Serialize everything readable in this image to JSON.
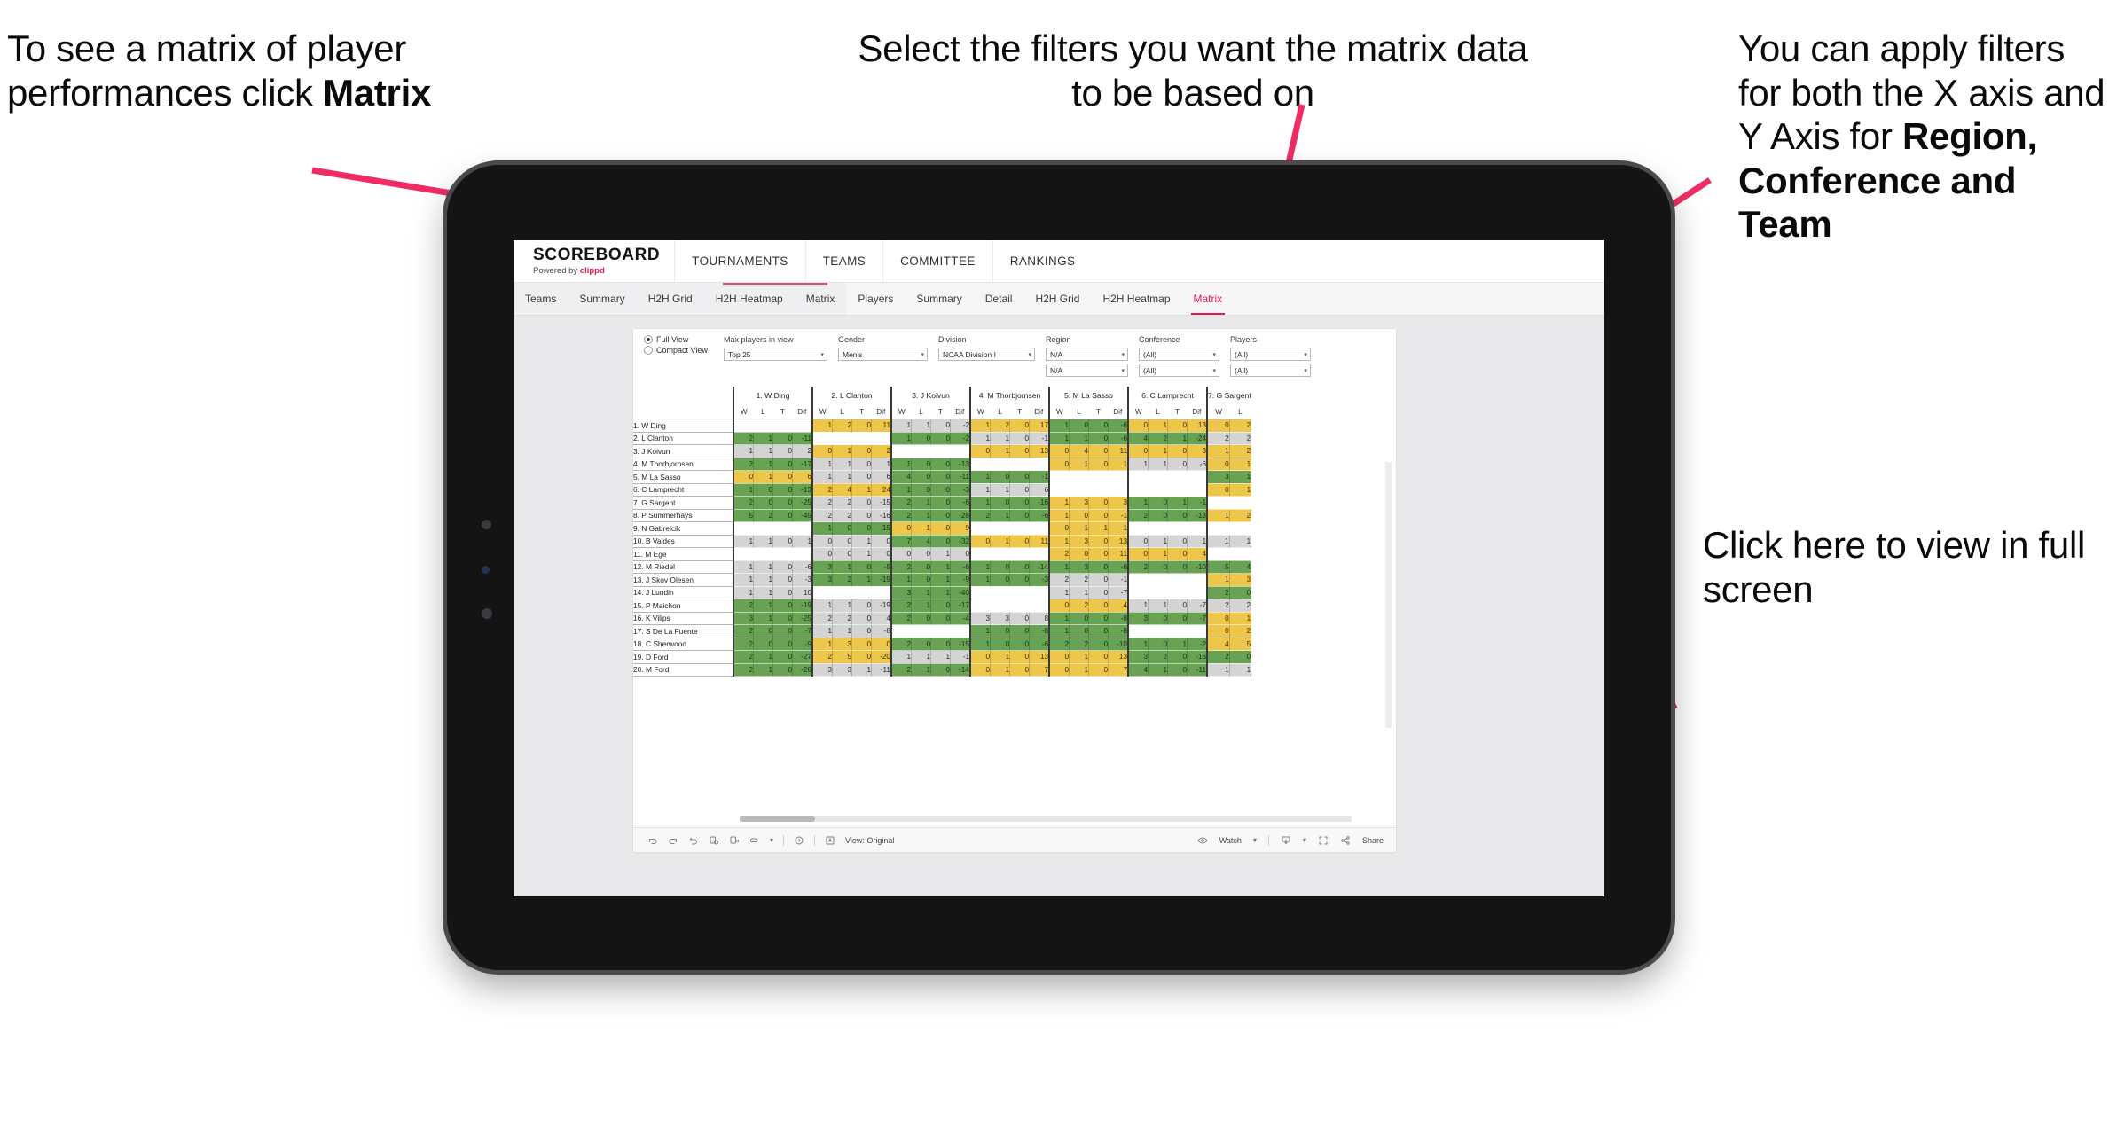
{
  "annotations": {
    "left": {
      "t1": "To see a matrix of player performances click ",
      "bold": "Matrix"
    },
    "middle": {
      "t1": "Select the filters you want the matrix data to be based on"
    },
    "right": {
      "t1": "You  can apply filters for both the X axis and Y Axis for ",
      "bold": "Region, Conference and Team"
    },
    "bottom": {
      "t1": "Click here to view in full screen"
    }
  },
  "brand": {
    "name": "SCOREBOARD",
    "powered": "Powered by ",
    "vendor": "clippd"
  },
  "topnav": [
    "TOURNAMENTS",
    "TEAMS",
    "COMMITTEE",
    "RANKINGS"
  ],
  "subnav": {
    "teams_group": [
      "Teams",
      "Summary",
      "H2H Grid",
      "H2H Heatmap",
      "Matrix"
    ],
    "players_group": [
      "Players",
      "Summary",
      "Detail",
      "H2H Grid",
      "H2H Heatmap",
      "Matrix"
    ],
    "active": "Matrix"
  },
  "filters": {
    "view_full": "Full View",
    "view_compact": "Compact View",
    "max_players_label": "Max players in view",
    "max_players_value": "Top 25",
    "gender_label": "Gender",
    "gender_value": "Men's",
    "division_label": "Division",
    "division_value": "NCAA Division I",
    "region_label": "Region",
    "region_value_x": "N/A",
    "region_value_y": "N/A",
    "conference_label": "Conference",
    "conference_value_x": "(All)",
    "conference_value_y": "(All)",
    "players_label": "Players",
    "players_value_x": "(All)",
    "players_value_y": "(All)"
  },
  "toolbar": {
    "view_label": "View: Original",
    "watch_label": "Watch",
    "share_label": "Share"
  },
  "chart_data": {
    "type": "table",
    "title": "Player head-to-head performance matrix",
    "sub_columns": [
      "W",
      "L",
      "T",
      "Dif"
    ],
    "column_players": [
      "1. W Ding",
      "2. L Clanton",
      "3. J Koivun",
      "4. M Thorbjornsen",
      "5. M La Sasso",
      "6. C Lamprecht",
      "7. G Sargent"
    ],
    "column_players_partial": "7. G Sargent",
    "row_players": [
      "1. W Ding",
      "2. L Clanton",
      "3. J Koivun",
      "4. M Thorbjornsen",
      "5. M La Sasso",
      "6. C Lamprecht",
      "7. G Sargent",
      "8. P Summerhays",
      "9. N Gabrelcik",
      "10. B Valdes",
      "11. M Ege",
      "12. M Riedel",
      "13. J Skov Olesen",
      "14. J Lundin",
      "15. P Maichon",
      "16. K Vilips",
      "17. S De La Fuente",
      "18. C Sherwood",
      "19. D Ford",
      "20. M Ford"
    ],
    "color_key": {
      "win": "#67a353",
      "loss": "#eec64a",
      "neutral": "#d4d4d4",
      "empty": "#ffffff"
    },
    "rows": [
      {
        "player": "1. W Ding",
        "cells": [
          [
            null,
            null,
            null,
            null,
            "e"
          ],
          [
            "1",
            "2",
            "0",
            "11",
            "y"
          ],
          [
            "1",
            "1",
            "0",
            "-2",
            "n"
          ],
          [
            "1",
            "2",
            "0",
            "17",
            "y"
          ],
          [
            "1",
            "0",
            "0",
            "-6",
            "g"
          ],
          [
            "0",
            "1",
            "0",
            "13",
            "y"
          ],
          [
            "0",
            "2",
            null,
            null,
            "y"
          ]
        ]
      },
      {
        "player": "2. L Clanton",
        "cells": [
          [
            "2",
            "1",
            "0",
            "-11",
            "g"
          ],
          [
            null,
            null,
            null,
            null,
            "e"
          ],
          [
            "1",
            "0",
            "0",
            "-2",
            "g"
          ],
          [
            "1",
            "1",
            "0",
            "-1",
            "n"
          ],
          [
            "1",
            "1",
            "0",
            "-6",
            "g"
          ],
          [
            "4",
            "2",
            "1",
            "-24",
            "g"
          ],
          [
            "2",
            "2",
            null,
            null,
            "n"
          ]
        ]
      },
      {
        "player": "3. J Koivun",
        "cells": [
          [
            "1",
            "1",
            "0",
            "2",
            "n"
          ],
          [
            "0",
            "1",
            "0",
            "2",
            "y"
          ],
          [
            null,
            null,
            null,
            null,
            "e"
          ],
          [
            "0",
            "1",
            "0",
            "13",
            "y"
          ],
          [
            "0",
            "4",
            "0",
            "11",
            "y"
          ],
          [
            "0",
            "1",
            "0",
            "3",
            "y"
          ],
          [
            "1",
            "2",
            null,
            null,
            "y"
          ]
        ]
      },
      {
        "player": "4. M Thorbjornsen",
        "cells": [
          [
            "2",
            "1",
            "0",
            "-17",
            "g"
          ],
          [
            "1",
            "1",
            "0",
            "1",
            "n"
          ],
          [
            "1",
            "0",
            "0",
            "-13",
            "g"
          ],
          [
            null,
            null,
            null,
            null,
            "e"
          ],
          [
            "0",
            "1",
            "0",
            "1",
            "y"
          ],
          [
            "1",
            "1",
            "0",
            "-6",
            "n"
          ],
          [
            "0",
            "1",
            null,
            null,
            "y"
          ]
        ]
      },
      {
        "player": "5. M La Sasso",
        "cells": [
          [
            "0",
            "1",
            "0",
            "6",
            "y"
          ],
          [
            "1",
            "1",
            "0",
            "6",
            "n"
          ],
          [
            "4",
            "0",
            "0",
            "-11",
            "g"
          ],
          [
            "1",
            "0",
            "0",
            "-1",
            "g"
          ],
          [
            null,
            null,
            null,
            null,
            "e"
          ],
          [
            null,
            null,
            null,
            null,
            "e"
          ],
          [
            "3",
            "1",
            null,
            null,
            "g"
          ]
        ]
      },
      {
        "player": "6. C Lamprecht",
        "cells": [
          [
            "1",
            "0",
            "0",
            "-13",
            "g"
          ],
          [
            "2",
            "4",
            "1",
            "24",
            "y"
          ],
          [
            "1",
            "0",
            "0",
            "-3",
            "g"
          ],
          [
            "1",
            "1",
            "0",
            "6",
            "n"
          ],
          [
            null,
            null,
            null,
            null,
            "e"
          ],
          [
            null,
            null,
            null,
            null,
            "e"
          ],
          [
            "0",
            "1",
            null,
            null,
            "y"
          ]
        ]
      },
      {
        "player": "7. G Sargent",
        "cells": [
          [
            "2",
            "0",
            "0",
            "-25",
            "g"
          ],
          [
            "2",
            "2",
            "0",
            "-15",
            "n"
          ],
          [
            "2",
            "1",
            "0",
            "-6",
            "g"
          ],
          [
            "1",
            "0",
            "0",
            "-16",
            "g"
          ],
          [
            "1",
            "3",
            "0",
            "3",
            "y"
          ],
          [
            "1",
            "0",
            "1",
            "-1",
            "g"
          ],
          [
            null,
            null,
            null,
            null,
            "e"
          ]
        ]
      },
      {
        "player": "8. P Summerhays",
        "cells": [
          [
            "5",
            "2",
            "0",
            "-45",
            "g"
          ],
          [
            "2",
            "2",
            "0",
            "-16",
            "n"
          ],
          [
            "2",
            "1",
            "0",
            "-28",
            "g"
          ],
          [
            "2",
            "1",
            "0",
            "-6",
            "g"
          ],
          [
            "1",
            "0",
            "0",
            "-1",
            "y"
          ],
          [
            "2",
            "0",
            "0",
            "-13",
            "g"
          ],
          [
            "1",
            "2",
            null,
            null,
            "y"
          ]
        ]
      },
      {
        "player": "9. N Gabrelcik",
        "cells": [
          [
            null,
            null,
            null,
            null,
            "e"
          ],
          [
            "1",
            "0",
            "0",
            "-15",
            "g"
          ],
          [
            "0",
            "1",
            "0",
            "9",
            "y"
          ],
          [
            null,
            null,
            null,
            null,
            "e"
          ],
          [
            "0",
            "1",
            "1",
            "1",
            "y"
          ],
          [
            null,
            null,
            null,
            null,
            "e"
          ],
          [
            null,
            null,
            null,
            null,
            "e"
          ]
        ]
      },
      {
        "player": "10. B Valdes",
        "cells": [
          [
            "1",
            "1",
            "0",
            "1",
            "n"
          ],
          [
            "0",
            "0",
            "1",
            "0",
            "n"
          ],
          [
            "7",
            "4",
            "0",
            "-32",
            "g"
          ],
          [
            "0",
            "1",
            "0",
            "11",
            "y"
          ],
          [
            "1",
            "3",
            "0",
            "13",
            "y"
          ],
          [
            "0",
            "1",
            "0",
            "1",
            "n"
          ],
          [
            "1",
            "1",
            null,
            null,
            "n"
          ]
        ]
      },
      {
        "player": "11. M Ege",
        "cells": [
          [
            null,
            null,
            null,
            null,
            "e"
          ],
          [
            "0",
            "0",
            "1",
            "0",
            "n"
          ],
          [
            "0",
            "0",
            "1",
            "0",
            "n"
          ],
          [
            null,
            null,
            null,
            null,
            "e"
          ],
          [
            "2",
            "0",
            "0",
            "11",
            "y"
          ],
          [
            "0",
            "1",
            "0",
            "4",
            "y"
          ],
          [
            null,
            null,
            null,
            null,
            "e"
          ]
        ]
      },
      {
        "player": "12. M Riedel",
        "cells": [
          [
            "1",
            "1",
            "0",
            "-6",
            "n"
          ],
          [
            "3",
            "1",
            "0",
            "-5",
            "g"
          ],
          [
            "2",
            "0",
            "1",
            "-6",
            "g"
          ],
          [
            "1",
            "0",
            "0",
            "-14",
            "g"
          ],
          [
            "1",
            "3",
            "0",
            "-6",
            "g"
          ],
          [
            "2",
            "0",
            "0",
            "-10",
            "g"
          ],
          [
            "5",
            "4",
            null,
            null,
            "g"
          ]
        ]
      },
      {
        "player": "13. J Skov Olesen",
        "cells": [
          [
            "1",
            "1",
            "0",
            "-3",
            "n"
          ],
          [
            "3",
            "2",
            "1",
            "-19",
            "g"
          ],
          [
            "1",
            "0",
            "1",
            "-9",
            "g"
          ],
          [
            "1",
            "0",
            "0",
            "-3",
            "g"
          ],
          [
            "2",
            "2",
            "0",
            "-1",
            "n"
          ],
          [
            null,
            null,
            null,
            null,
            "e"
          ],
          [
            "1",
            "3",
            null,
            null,
            "y"
          ]
        ]
      },
      {
        "player": "14. J Lundin",
        "cells": [
          [
            "1",
            "1",
            "0",
            "10",
            "n"
          ],
          [
            null,
            null,
            null,
            null,
            "e"
          ],
          [
            "3",
            "1",
            "1",
            "-40",
            "g"
          ],
          [
            null,
            null,
            null,
            null,
            "e"
          ],
          [
            "1",
            "1",
            "0",
            "-7",
            "n"
          ],
          [
            null,
            null,
            null,
            null,
            "e"
          ],
          [
            "2",
            "0",
            null,
            null,
            "g"
          ]
        ]
      },
      {
        "player": "15. P Maichon",
        "cells": [
          [
            "2",
            "1",
            "0",
            "-19",
            "g"
          ],
          [
            "1",
            "1",
            "0",
            "-19",
            "n"
          ],
          [
            "2",
            "1",
            "0",
            "-17",
            "g"
          ],
          [
            null,
            null,
            null,
            null,
            "e"
          ],
          [
            "0",
            "2",
            "0",
            "4",
            "y"
          ],
          [
            "1",
            "1",
            "0",
            "-7",
            "n"
          ],
          [
            "2",
            "2",
            null,
            null,
            "n"
          ]
        ]
      },
      {
        "player": "16. K Vilips",
        "cells": [
          [
            "3",
            "1",
            "0",
            "-25",
            "g"
          ],
          [
            "2",
            "2",
            "0",
            "4",
            "n"
          ],
          [
            "2",
            "0",
            "0",
            "-4",
            "g"
          ],
          [
            "3",
            "3",
            "0",
            "8",
            "n"
          ],
          [
            "1",
            "0",
            "0",
            "-8",
            "g"
          ],
          [
            "3",
            "0",
            "0",
            "-7",
            "g"
          ],
          [
            "0",
            "1",
            null,
            null,
            "y"
          ]
        ]
      },
      {
        "player": "17. S De La Fuente",
        "cells": [
          [
            "2",
            "0",
            "0",
            "-7",
            "g"
          ],
          [
            "1",
            "1",
            "0",
            "-8",
            "n"
          ],
          [
            null,
            null,
            null,
            null,
            "e"
          ],
          [
            "1",
            "0",
            "0",
            "-8",
            "g"
          ],
          [
            "1",
            "0",
            "0",
            "-8",
            "g"
          ],
          [
            null,
            null,
            null,
            null,
            "e"
          ],
          [
            "0",
            "2",
            null,
            null,
            "y"
          ]
        ]
      },
      {
        "player": "18. C Sherwood",
        "cells": [
          [
            "2",
            "0",
            "0",
            "-9",
            "g"
          ],
          [
            "1",
            "3",
            "0",
            "0",
            "y"
          ],
          [
            "2",
            "0",
            "0",
            "-15",
            "g"
          ],
          [
            "1",
            "0",
            "0",
            "-6",
            "g"
          ],
          [
            "2",
            "2",
            "0",
            "-10",
            "g"
          ],
          [
            "1",
            "0",
            "1",
            "-2",
            "g"
          ],
          [
            "4",
            "5",
            null,
            null,
            "y"
          ]
        ]
      },
      {
        "player": "19. D Ford",
        "cells": [
          [
            "2",
            "1",
            "0",
            "-27",
            "g"
          ],
          [
            "2",
            "5",
            "0",
            "-20",
            "y"
          ],
          [
            "1",
            "1",
            "1",
            "-1",
            "n"
          ],
          [
            "0",
            "1",
            "0",
            "13",
            "y"
          ],
          [
            "0",
            "1",
            "0",
            "13",
            "y"
          ],
          [
            "3",
            "2",
            "0",
            "-16",
            "g"
          ],
          [
            "2",
            "0",
            null,
            null,
            "g"
          ]
        ]
      },
      {
        "player": "20. M Ford",
        "cells": [
          [
            "2",
            "1",
            "0",
            "-28",
            "g"
          ],
          [
            "3",
            "3",
            "1",
            "-11",
            "n"
          ],
          [
            "2",
            "1",
            "0",
            "-14",
            "g"
          ],
          [
            "0",
            "1",
            "0",
            "7",
            "y"
          ],
          [
            "0",
            "1",
            "0",
            "7",
            "y"
          ],
          [
            "4",
            "1",
            "0",
            "-11",
            "g"
          ],
          [
            "1",
            "1",
            null,
            null,
            "n"
          ]
        ]
      }
    ]
  }
}
